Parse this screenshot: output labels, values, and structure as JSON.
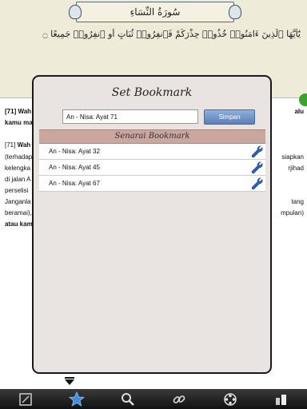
{
  "surah": {
    "name_arabic": "سُورَةُ النِّسَاءِ",
    "verse_arabic": "يَٰٓأَيُّهَا ٱلَّذِينَ ءَامَنُوا۟ خُذُوا۟ حِذْرَكُمْ فَٱنفِرُوا۟ ثُبَاتٍ أَوِ ٱنفِرُوا۟ جَمِيعًا ۝"
  },
  "translation": {
    "line1_ref": "[71]",
    "line1_text": "Wah",
    "line1_end": "alu",
    "line2": "kamu ma",
    "line3_ref": "[71]",
    "line3_text": "Wah",
    "line4": "(terhadap",
    "line4_end": "siapkan",
    "line5": "kelengka",
    "line5_end": "rjihad",
    "line6": "di jalan A",
    "line7": "perselisi",
    "line8": "Janganla",
    "line8_end": "tang",
    "line9": "beramai),",
    "line9_end": "mpulan)",
    "line10": "atau kam"
  },
  "dialog": {
    "title": "Set Bookmark",
    "input_value": "An - Nisa: Ayat 71",
    "save_label": "Simpan",
    "list_header": "Senarai Bookmark",
    "bookmarks": [
      {
        "label": "An - Nisa: Ayat 32"
      },
      {
        "label": "An - Nisa: Ayat 45"
      },
      {
        "label": "An - Nisa: Ayat 67"
      }
    ]
  },
  "toolbar": {
    "buttons": [
      {
        "icon": "edit-note-icon"
      },
      {
        "icon": "star-bookmark-icon",
        "active": true
      },
      {
        "icon": "search-icon"
      },
      {
        "icon": "link-icon"
      },
      {
        "icon": "settings-wheel-icon"
      },
      {
        "icon": "pages-icon"
      }
    ],
    "active_color": "#3b8ee0"
  }
}
